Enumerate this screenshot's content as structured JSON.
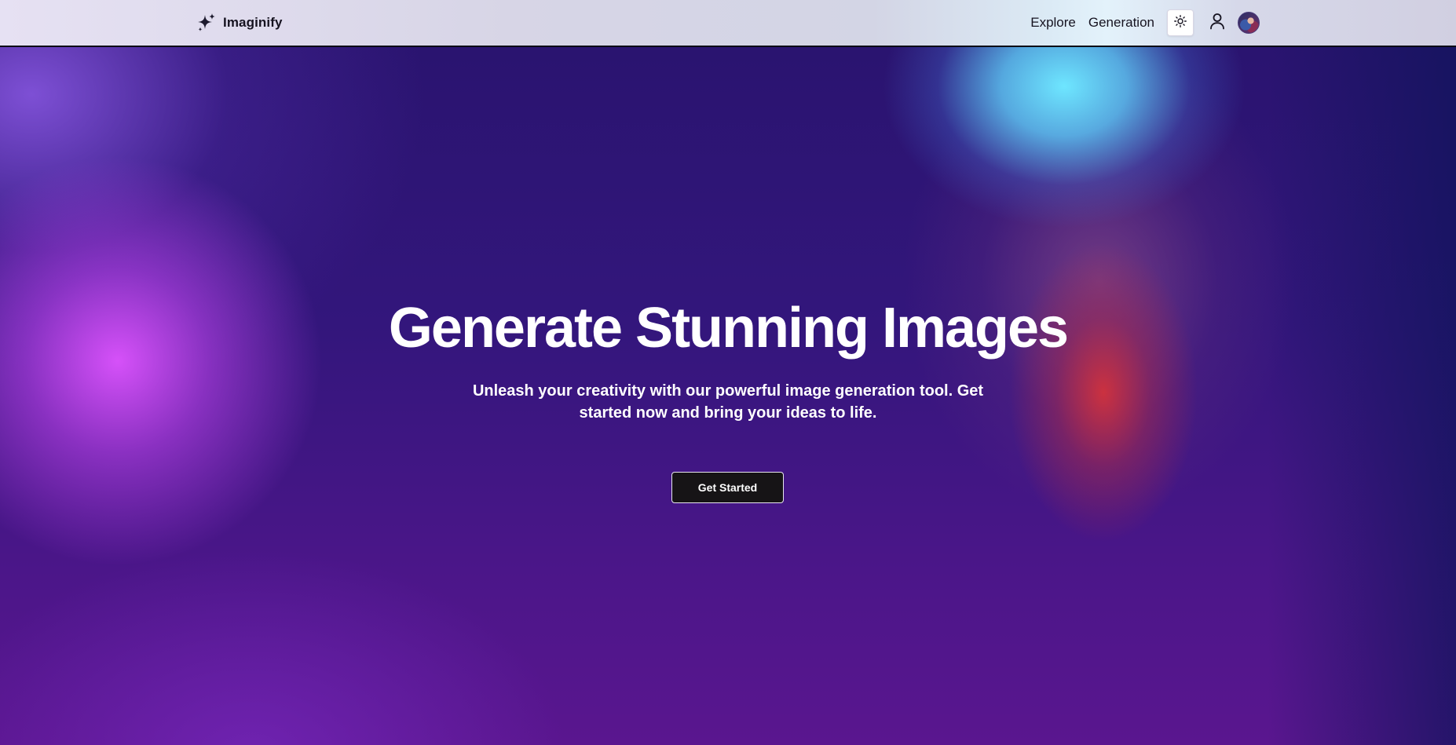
{
  "header": {
    "brand": {
      "name": "Imaginify",
      "icon": "sparkles-icon"
    },
    "nav": {
      "links": [
        {
          "label": "Explore"
        },
        {
          "label": "Generation"
        }
      ],
      "theme_toggle_icon": "sun-icon",
      "user_icon": "user-icon",
      "avatar": "user-avatar"
    }
  },
  "hero": {
    "headline": "Generate Stunning Images",
    "subheadline": "Unleash your creativity with our powerful image generation tool. Get started now and bring your ideas to life.",
    "cta_label": "Get Started"
  },
  "colors": {
    "header_bg": "#d7d5e6",
    "text_dark": "#161320",
    "hero_bg": "#2a1470",
    "accent_magenta": "#de54ff",
    "accent_cyan": "#6ee6ff",
    "accent_red": "#d2323c",
    "button_bg": "#161416",
    "button_text": "#ffffff"
  }
}
